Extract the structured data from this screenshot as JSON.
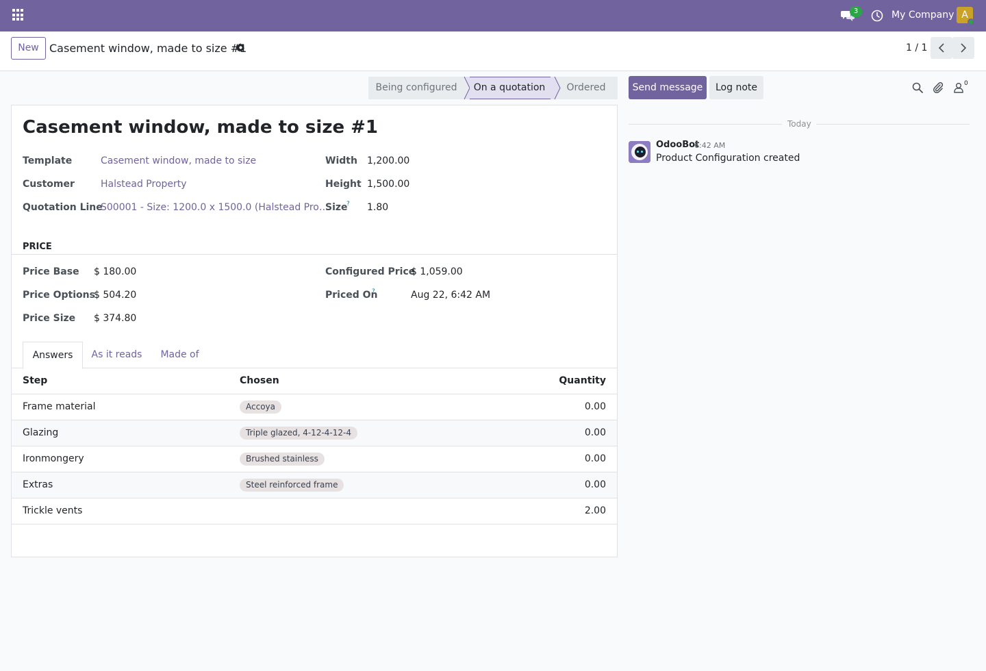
{
  "navbar": {
    "messages_count": "3",
    "company": "My Company",
    "user_initial": "A",
    "accent_color": "#71639e"
  },
  "control_panel": {
    "new_label": "New",
    "breadcrumb": "Casement window, made to size #1",
    "pager": "1 / 1"
  },
  "statusbar": {
    "stages": [
      "Being configured",
      "On a quotation",
      "Ordered"
    ],
    "current": "On a quotation"
  },
  "form": {
    "title": "Casement window, made to size #1",
    "fields": {
      "template": {
        "label": "Template",
        "value": "Casement window, made to size"
      },
      "customer": {
        "label": "Customer",
        "value": "Halstead Property"
      },
      "quotation_line": {
        "label": "Quotation Line",
        "value": "S00001 - Size: 1200.0 x 1500.0 (Halstead Pro…"
      },
      "width": {
        "label": "Width",
        "value": "1,200.00"
      },
      "height": {
        "label": "Height",
        "value": "1,500.00"
      },
      "size": {
        "label": "Size",
        "help": "?",
        "value": "1.80"
      }
    },
    "price_section": {
      "title": "PRICE",
      "price_base": {
        "label": "Price Base",
        "value": "$ 180.00"
      },
      "price_options": {
        "label": "Price Options",
        "value": "$ 504.20"
      },
      "price_size": {
        "label": "Price Size",
        "value": "$ 374.80"
      },
      "configured_price": {
        "label": "Configured Price",
        "value": "$ 1,059.00"
      },
      "priced_on": {
        "label": "Priced On",
        "help": "?",
        "value": "Aug 22, 6:42 AM"
      }
    },
    "tabs": [
      "Answers",
      "As it reads",
      "Made of"
    ],
    "active_tab": "Answers",
    "table": {
      "columns": [
        "Step",
        "Chosen",
        "Quantity"
      ],
      "rows": [
        {
          "step": "Frame material",
          "chosen": "Accoya",
          "quantity": "0.00"
        },
        {
          "step": "Glazing",
          "chosen": "Triple glazed, 4-12-4-12-4",
          "quantity": "0.00"
        },
        {
          "step": "Ironmongery",
          "chosen": "Brushed stainless",
          "quantity": "0.00"
        },
        {
          "step": "Extras",
          "chosen": "Steel reinforced frame",
          "quantity": "0.00"
        },
        {
          "step": "Trickle vents",
          "chosen": "",
          "quantity": "2.00"
        }
      ]
    }
  },
  "chatter": {
    "send_label": "Send message",
    "log_label": "Log note",
    "followers_count": "0",
    "day_label": "Today",
    "messages": [
      {
        "author": "OdooBot",
        "time": "6:42 AM",
        "body": "Product Configuration created"
      }
    ]
  }
}
